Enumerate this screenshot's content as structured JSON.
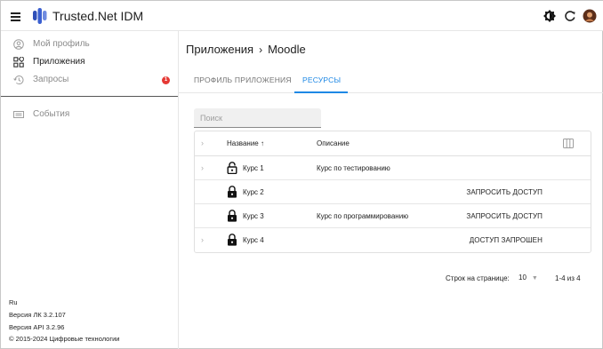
{
  "app": {
    "title": "Trusted.Net IDM"
  },
  "sidebar": {
    "items": [
      {
        "label": "Мой профиль",
        "icon": "account-circle-icon"
      },
      {
        "label": "Приложения",
        "icon": "apps-grid-icon"
      },
      {
        "label": "Запросы",
        "icon": "history-icon",
        "badge": "1"
      },
      {
        "label": "События",
        "icon": "list-icon"
      }
    ]
  },
  "footer": {
    "language": "Ru",
    "version_lk": "Версия ЛК 3.2.107",
    "version_api": "Версия API 3.2.96",
    "copyright": "© 2015-2024 Цифровые технологии"
  },
  "breadcrumb": {
    "parent": "Приложения",
    "separator": "›",
    "current": "Moodle"
  },
  "tabs": [
    {
      "label": "ПРОФИЛЬ ПРИЛОЖЕНИЯ",
      "active": false
    },
    {
      "label": "РЕСУРСЫ",
      "active": true
    }
  ],
  "search": {
    "placeholder": "Поиск",
    "value": ""
  },
  "table": {
    "columns": {
      "name": "Название",
      "sort_indicator": "↑",
      "description": "Описание"
    },
    "rows": [
      {
        "name": "Курс 1",
        "description": "Курс по тестированию",
        "action": "",
        "lock": "unlocked",
        "expandable": true
      },
      {
        "name": "Курс 2",
        "description": "",
        "action": "ЗАПРОСИТЬ ДОСТУП",
        "lock": "locked",
        "expandable": false
      },
      {
        "name": "Курс 3",
        "description": "Курс по программированию",
        "action": "ЗАПРОСИТЬ ДОСТУП",
        "lock": "locked",
        "expandable": false
      },
      {
        "name": "Курс 4",
        "description": "",
        "action": "ДОСТУП ЗАПРОШЕН",
        "lock": "locked",
        "expandable": true
      }
    ]
  },
  "pagination": {
    "rows_per_page_label": "Строк на странице:",
    "rows_per_page_value": "10",
    "range": "1-4 из 4"
  },
  "colors": {
    "accent": "#1e88e5",
    "badge": "#e53935",
    "logo": "#2f4fb8"
  }
}
